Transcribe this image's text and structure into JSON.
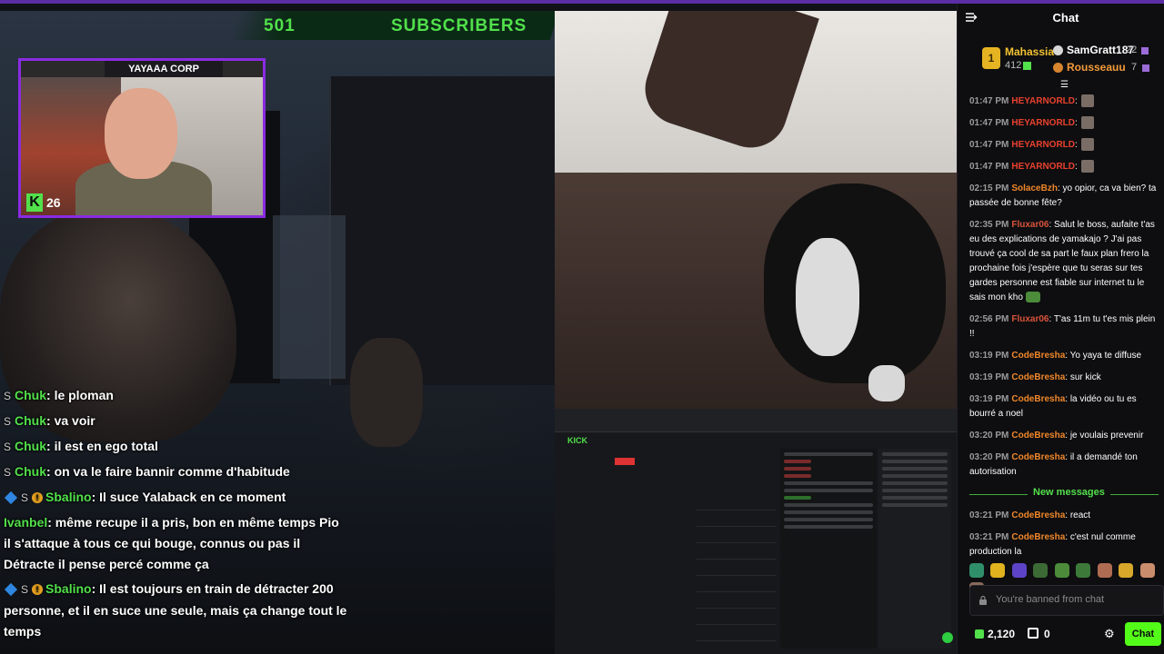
{
  "stream": {
    "subscriber_count": "501",
    "subscriber_label": "SUBSCRIBERS",
    "webcam_title": "YAYAAA CORP",
    "webcam_logo": "K",
    "webcam_count": "26",
    "overlay_chat": [
      {
        "name": "Chuk",
        "text": ": le ploman",
        "badge": "S"
      },
      {
        "name": "Chuk",
        "text": ": va voir",
        "badge": "S"
      },
      {
        "name": "Chuk",
        "text": ": il est en ego total",
        "badge": "S"
      },
      {
        "name": "Chuk",
        "text": ": on va le faire bannir comme d'habitude",
        "badge": "S"
      },
      {
        "name": "Sbalino",
        "text": ": Il suce Yalaback en ce moment",
        "badge": "S"
      },
      {
        "name": "Ivanbel",
        "text": ": même recupe il a pris, bon en même temps Pio il s'attaque à tous ce qui bouge, connus ou pas il Détracte il pense percé comme ça",
        "badge": ""
      },
      {
        "name": "Sbalino",
        "text": ": Il est toujours en train de détracter 200 personne, et il en suce une seule, mais ça change tout le temps",
        "badge": "S"
      }
    ],
    "kick_brand": "KICK"
  },
  "chat": {
    "title": "Chat",
    "leaderboard": {
      "first": {
        "rank": "1",
        "name": "Mahassia",
        "value": "412"
      },
      "second": {
        "name": "SamGratt187",
        "value": "22"
      },
      "third": {
        "name": "Rousseauu",
        "value": "7"
      }
    },
    "messages": [
      {
        "time": "01:47 PM",
        "user": "HEYARNORLD",
        "text": ":",
        "color": "u-red",
        "avatar": true
      },
      {
        "time": "01:47 PM",
        "user": "HEYARNORLD",
        "text": ":",
        "color": "u-red",
        "avatar": true
      },
      {
        "time": "01:47 PM",
        "user": "HEYARNORLD",
        "text": ":",
        "color": "u-red",
        "avatar": true
      },
      {
        "time": "01:47 PM",
        "user": "HEYARNORLD",
        "text": ":",
        "color": "u-red",
        "avatar": true
      },
      {
        "time": "02:15 PM",
        "user": "SolaceBzh",
        "text": ": yo opior, ca va bien? ta passée de bonne fête?",
        "color": "u-orange"
      },
      {
        "time": "02:35 PM",
        "user": "Fluxar06",
        "text": ": Salut le boss, aufaite t'as eu des explications de yamakajo ? J'ai pas trouvé ça cool de sa part le faux plan frero la prochaine fois j'espère que tu seras sur tes gardes personne est fiable sur internet tu le sais mon kho",
        "color": "u-red2",
        "emote": true
      },
      {
        "time": "02:56 PM",
        "user": "Fluxar06",
        "text": ": T'as 11m tu t'es mis plein !!",
        "color": "u-red2"
      },
      {
        "time": "03:19 PM",
        "user": "CodeBresha",
        "text": ": Yo yaya te diffuse",
        "color": "u-orange"
      },
      {
        "time": "03:19 PM",
        "user": "CodeBresha",
        "text": ": sur kick",
        "color": "u-orange"
      },
      {
        "time": "03:19 PM",
        "user": "CodeBresha",
        "text": ": la vidéo ou tu es bourré a noel",
        "color": "u-orange"
      },
      {
        "time": "03:20 PM",
        "user": "CodeBresha",
        "text": ": je voulais prevenir",
        "color": "u-orange"
      },
      {
        "time": "03:20 PM",
        "user": "CodeBresha",
        "text": ": il a demandé ton autorisation",
        "color": "u-orange"
      }
    ],
    "new_messages_label": "New messages",
    "new_messages": [
      {
        "time": "03:21 PM",
        "user": "CodeBresha",
        "text": ": react",
        "color": "u-orange"
      },
      {
        "time": "03:21 PM",
        "user": "CodeBresha",
        "text": ": c'est nul comme production la",
        "color": "u-orange"
      }
    ],
    "input_placeholder": "You're banned from chat",
    "kicks_balance": "2,120",
    "gifts_count": "0",
    "send_label": "Chat"
  },
  "colors": {
    "accent": "#53fc18",
    "brand_purple": "#5b2ea6",
    "cam_border": "#8a2be2"
  }
}
